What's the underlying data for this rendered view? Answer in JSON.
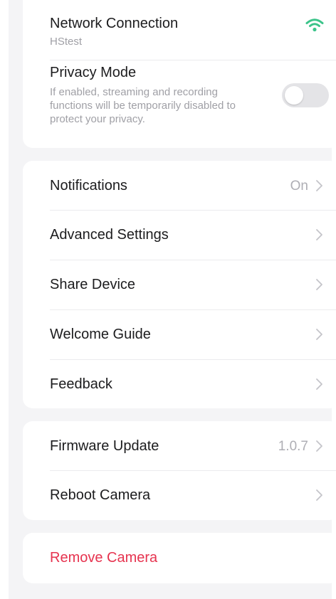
{
  "colors": {
    "background": "#f4f4f6",
    "card": "#ffffff",
    "text": "#1c1c1e",
    "secondary": "#a0a0a6",
    "wifi": "#3cc48a",
    "toggle_off": "#e4e4e7",
    "danger": "#e6334f"
  },
  "network": {
    "label": "Network Connection",
    "ssid": "HStest",
    "icon": "wifi-icon"
  },
  "privacy": {
    "label": "Privacy Mode",
    "description": "If enabled, streaming and recording functions will be temporarily disabled to protect your privacy.",
    "enabled": false
  },
  "settings": {
    "notifications": {
      "label": "Notifications",
      "value": "On"
    },
    "advanced": {
      "label": "Advanced Settings"
    },
    "share": {
      "label": "Share Device"
    },
    "welcome": {
      "label": "Welcome Guide"
    },
    "feedback": {
      "label": "Feedback"
    }
  },
  "device": {
    "firmware": {
      "label": "Firmware Update",
      "value": "1.0.7"
    },
    "reboot": {
      "label": "Reboot Camera"
    }
  },
  "remove": {
    "label": "Remove Camera"
  },
  "icons": {
    "chevron": "chevron-right-icon",
    "toggle": "toggle-switch"
  }
}
